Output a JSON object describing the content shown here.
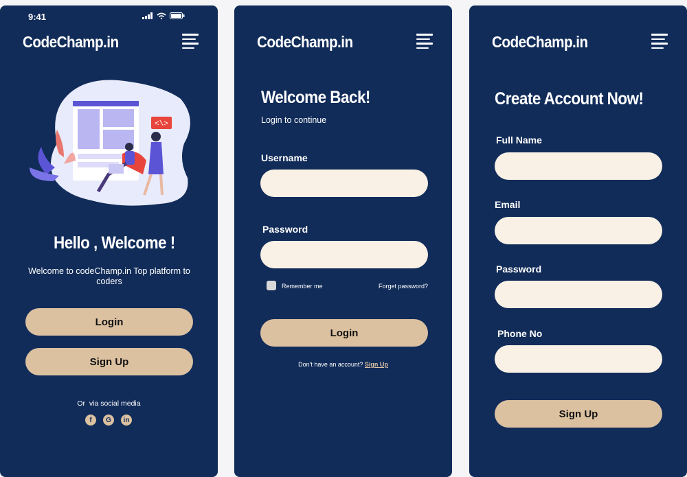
{
  "status": {
    "time": "9:41"
  },
  "brand": "CodeChamp.in",
  "welcome": {
    "title": "Hello , Welcome !",
    "subtitle": "Welcome to codeChamp.in Top platform to coders",
    "login": "Login",
    "signup": "Sign Up",
    "social_text": "Or  via social media",
    "social": [
      "f",
      "G",
      "in"
    ],
    "code_badge": "<\\>"
  },
  "login": {
    "title": "Welcome Back!",
    "subtitle": "Login to continue",
    "username_label": "Username",
    "password_label": "Password",
    "remember": "Remember me",
    "forgot": "Forget password?",
    "button": "Login",
    "no_account": "Don't have an account?",
    "signup_link": "Sign Up"
  },
  "register": {
    "title": "Create Account Now!",
    "fullname_label": "Full Name",
    "email_label": "Email",
    "password_label": "Password",
    "phone_label": "Phone No",
    "button": "Sign Up"
  }
}
